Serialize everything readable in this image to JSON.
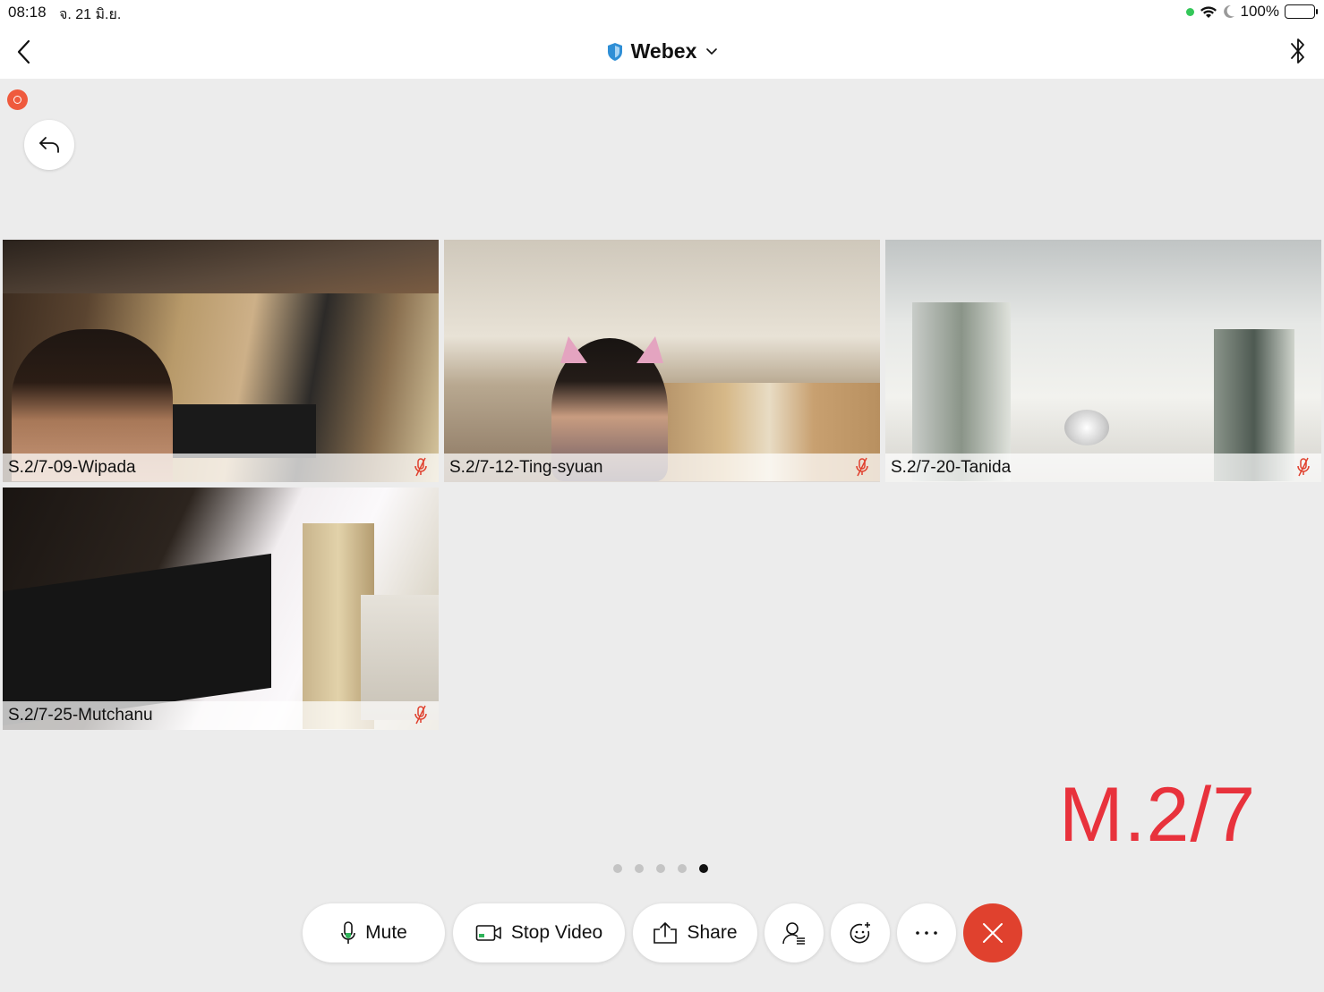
{
  "status_bar": {
    "time": "08:18",
    "date": "จ. 21 มิ.ย.",
    "battery": "100%"
  },
  "nav": {
    "title": "Webex"
  },
  "participants": [
    {
      "name": "S.2/7-09-Wipada",
      "muted": true
    },
    {
      "name": "S.2/7-12-Ting-syuan",
      "muted": true
    },
    {
      "name": "S.2/7-20-Tanida",
      "muted": true
    },
    {
      "name": "S.2/7-25-Mutchanu",
      "muted": true
    }
  ],
  "pagination": {
    "pages": 5,
    "current": 5
  },
  "watermark": "M.2/7",
  "controls": {
    "mute_label": "Mute",
    "stop_video_label": "Stop Video",
    "share_label": "Share"
  },
  "colors": {
    "end_call": "#e0412e",
    "watermark": "#e8323c",
    "muted_mic": "#e0412e"
  }
}
